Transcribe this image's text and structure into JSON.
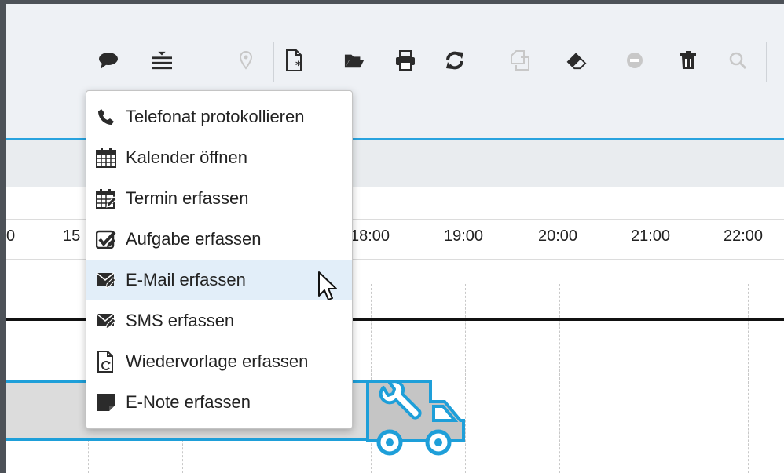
{
  "toolbar": {
    "icons": [
      "speech-bubble-icon",
      "list-icon",
      "map-pin-icon",
      "new-document-icon",
      "open-folder-icon",
      "print-icon",
      "refresh-icon",
      "copy-icon",
      "eraser-icon",
      "minus-circle-icon",
      "trash-icon",
      "search-icon"
    ]
  },
  "timeline": {
    "labels": [
      "0",
      "15",
      "18:00",
      "19:00",
      "20:00",
      "21:00",
      "22:00"
    ]
  },
  "menu": {
    "hover_index": 4,
    "items": [
      {
        "label": "Telefonat protokollieren",
        "icon": "phone-icon"
      },
      {
        "label": "Kalender öffnen",
        "icon": "calendar-icon"
      },
      {
        "label": "Termin erfassen",
        "icon": "calendar-edit-icon"
      },
      {
        "label": "Aufgabe erfassen",
        "icon": "task-check-icon"
      },
      {
        "label": "E-Mail erfassen",
        "icon": "mail-edit-icon"
      },
      {
        "label": "SMS erfassen",
        "icon": "sms-edit-icon"
      },
      {
        "label": "Wiedervorlage erfassen",
        "icon": "followup-document-icon"
      },
      {
        "label": "E-Note erfassen",
        "icon": "note-icon"
      }
    ]
  },
  "colors": {
    "accent": "#29a3df",
    "toolbar_bg": "#eef1f5",
    "icon": "#2b2b2b",
    "icon_disabled": "#c8c8c8",
    "menu_hover": "#e2eef9",
    "frame": "#4d5258"
  }
}
